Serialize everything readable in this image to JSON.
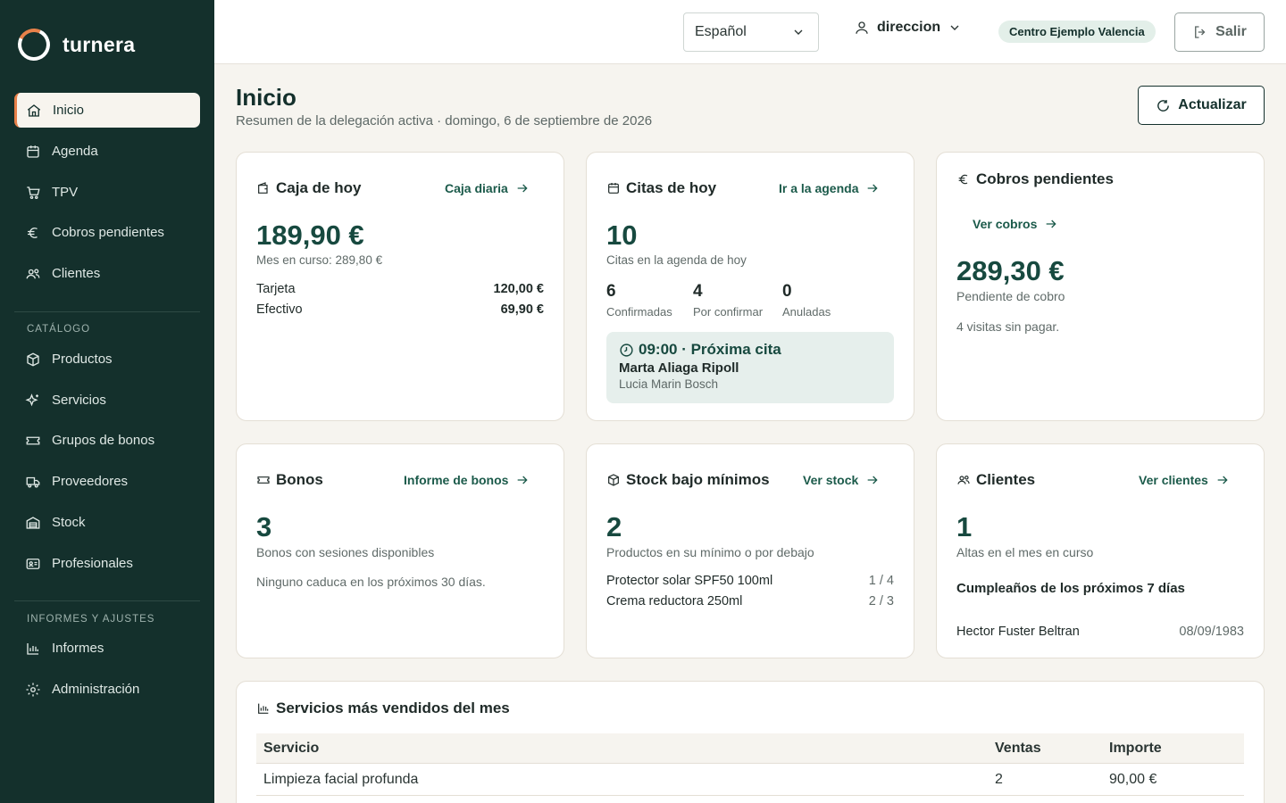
{
  "app": {
    "name": "turnera"
  },
  "sidebar": {
    "items": [
      {
        "label": "Inicio",
        "icon": "home-icon"
      },
      {
        "label": "Agenda",
        "icon": "calendar-icon"
      },
      {
        "label": "TPV",
        "icon": "cart-icon"
      },
      {
        "label": "Cobros pendientes",
        "icon": "euro-icon"
      },
      {
        "label": "Clientes",
        "icon": "users-icon"
      }
    ],
    "catalog_heading": "CATÁLOGO",
    "catalog_items": [
      {
        "label": "Productos",
        "icon": "box-icon"
      },
      {
        "label": "Servicios",
        "icon": "sparkles-icon"
      },
      {
        "label": "Grupos de bonos",
        "icon": "ticket-icon"
      },
      {
        "label": "Proveedores",
        "icon": "truck-icon"
      },
      {
        "label": "Stock",
        "icon": "warehouse-icon"
      },
      {
        "label": "Profesionales",
        "icon": "id-card-icon"
      }
    ],
    "reports_heading": "INFORMES Y AJUSTES",
    "reports_items": [
      {
        "label": "Informes",
        "icon": "bar-chart-icon"
      },
      {
        "label": "Administración",
        "icon": "gear-icon"
      }
    ]
  },
  "topbar": {
    "language": "Español",
    "user": "direccion",
    "center": "Centro Ejemplo Valencia",
    "logout": "Salir"
  },
  "header": {
    "title": "Inicio",
    "subtitle": "Resumen de la delegación activa · domingo, 6 de septiembre de 2026",
    "refresh": "Actualizar"
  },
  "caja": {
    "title": "Caja de hoy",
    "link": "Caja diaria",
    "amount": "189,90 €",
    "month": "Mes en curso: 289,80 €",
    "rows": [
      {
        "label": "Tarjeta",
        "value": "120,00 €"
      },
      {
        "label": "Efectivo",
        "value": "69,90 €"
      }
    ]
  },
  "citas": {
    "title": "Citas de hoy",
    "link": "Ir a la agenda",
    "count": "10",
    "caption": "Citas en la agenda de hoy",
    "stats": [
      {
        "n": "6",
        "l": "Confirmadas"
      },
      {
        "n": "4",
        "l": "Por confirmar"
      },
      {
        "n": "0",
        "l": "Anuladas"
      }
    ],
    "next": {
      "heading": "09:00 · Próxima cita",
      "client": "Marta Aliaga Ripoll",
      "professional": "Lucia Marin Bosch"
    }
  },
  "cobros": {
    "title": "Cobros pendientes",
    "link": "Ver cobros",
    "amount": "289,30 €",
    "caption": "Pendiente de cobro",
    "note": "4 visitas sin pagar."
  },
  "bonos": {
    "title": "Bonos",
    "link": "Informe de bonos",
    "count": "3",
    "caption": "Bonos con sesiones disponibles",
    "note": "Ninguno caduca en los próximos 30 días."
  },
  "stock": {
    "title": "Stock bajo mínimos",
    "link": "Ver stock",
    "count": "2",
    "caption": "Productos en su mínimo o por debajo",
    "rows": [
      {
        "label": "Protector solar SPF50 100ml",
        "value": "1 / 4"
      },
      {
        "label": "Crema reductora 250ml",
        "value": "2 / 3"
      }
    ]
  },
  "clientes": {
    "title": "Clientes",
    "link": "Ver clientes",
    "count": "1",
    "caption": "Altas en el mes en curso",
    "birthdays_heading": "Cumpleaños de los próximos 7 días",
    "birthdays": [
      {
        "name": "Hector Fuster Beltran",
        "date": "08/09/1983"
      }
    ]
  },
  "top_services": {
    "title": "Servicios más vendidos del mes",
    "columns": [
      "Servicio",
      "Ventas",
      "Importe"
    ],
    "rows": [
      {
        "service": "Limpieza facial profunda",
        "sales": "2",
        "amount": "90,00 €"
      }
    ]
  },
  "colors": {
    "sidebar": "#14302c",
    "accent": "#e8814a",
    "primary": "#17493f",
    "background": "#f6f4ef"
  }
}
